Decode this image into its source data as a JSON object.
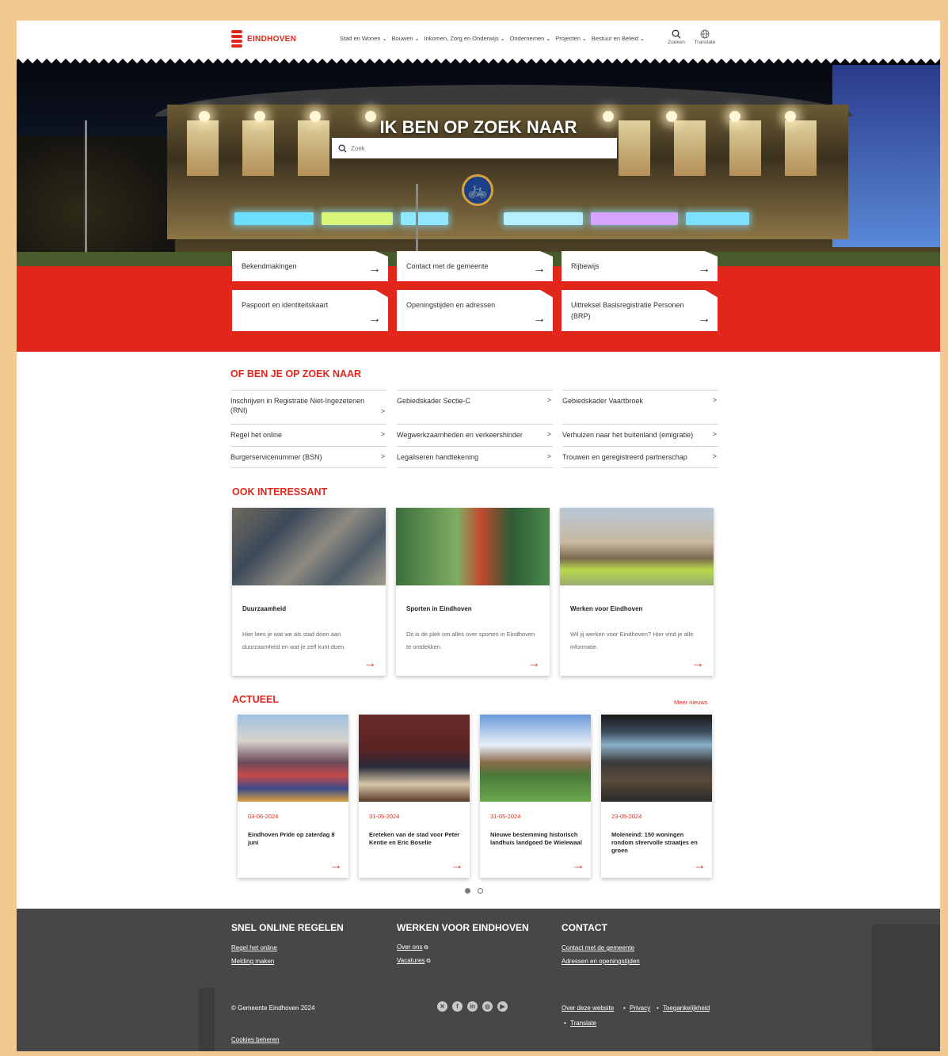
{
  "header": {
    "logo_text": "EINDHOVEN",
    "nav": [
      {
        "label": "Stad en Wonen"
      },
      {
        "label": "Bouwen"
      },
      {
        "label": "Inkomen, Zorg en Onderwijs"
      },
      {
        "label": "Ondernemen"
      },
      {
        "label": "Projecten"
      },
      {
        "label": "Bestuur en Beleid"
      }
    ],
    "search_label": "Zoeken",
    "translate_label": "Translate"
  },
  "hero": {
    "title": "IK BEN OP ZOEK NAAR",
    "search_placeholder": "Zoek",
    "quick_links": [
      {
        "label": "Bekendmakingen"
      },
      {
        "label": "Contact met de gemeente"
      },
      {
        "label": "Rijbewijs"
      },
      {
        "label": "Paspoort en identiteitskaart"
      },
      {
        "label": "Openingstijden en adressen"
      },
      {
        "label": "Uittreksel Basisregistratie Personen (BRP)"
      }
    ]
  },
  "search_more": {
    "title": "OF BEN JE OP ZOEK NAAR",
    "links": [
      {
        "label": "Inschrijven in Registratie Niet-Ingezetenen (RNI)"
      },
      {
        "label": "Gebiedskader Sectie-C"
      },
      {
        "label": "Gebiedskader Vaartbroek"
      },
      {
        "label": "Regel het online"
      },
      {
        "label": "Wegwerkzaamheden en verkeershinder"
      },
      {
        "label": "Verhuizen naar het buitenland (emigratie)"
      },
      {
        "label": "Burgerservicenummer (BSN)"
      },
      {
        "label": "Legaliseren handtekening"
      },
      {
        "label": "Trouwen en geregistreerd partnerschap"
      }
    ]
  },
  "interesting": {
    "title": "OOK INTERESSANT",
    "cards": [
      {
        "title": "Duurzaamheid",
        "desc": "Hier lees je wat we als stad doen aan duurzaamheid en wat je zelf kunt doen."
      },
      {
        "title": "Sporten in Eindhoven",
        "desc": "Dit is de plek om alles over sporten in Eindhoven te ontdekken."
      },
      {
        "title": "Werken voor Eindhoven",
        "desc": "Wil jij werken voor Eindhoven? Hier vind je alle informatie."
      }
    ]
  },
  "news": {
    "title": "ACTUEEL",
    "more_label": "Meer nieuws",
    "items": [
      {
        "date": "03-06-2024",
        "title": "Eindhoven Pride op zaterdag 8 juni"
      },
      {
        "date": "31-05-2024",
        "title": "Ereteken van de stad voor Peter Kentie en Eric Boselie"
      },
      {
        "date": "31-05-2024",
        "title": "Nieuwe bestemming historisch landhuis landgoed De Wielewaal"
      },
      {
        "date": "23-05-2024",
        "title": "Moleneind: 150 woningen rondom sfeervolle straatjes en groen"
      }
    ]
  },
  "footer": {
    "col1_title": "SNEL ONLINE REGELEN",
    "col1_links": [
      {
        "label": "Regel het online"
      },
      {
        "label": "Melding maken"
      }
    ],
    "col2_title": "WERKEN VOOR EINDHOVEN",
    "col2_links": [
      {
        "label": "Over ons"
      },
      {
        "label": "Vacatures"
      }
    ],
    "col3_title": "CONTACT",
    "col3_links": [
      {
        "label": "Contact met de gemeente"
      },
      {
        "label": "Adressen en openingstijden"
      }
    ],
    "copyright": "© Gemeente Eindhoven 2024",
    "legal_links": [
      {
        "label": "Over deze website"
      },
      {
        "label": "Privacy"
      },
      {
        "label": "Toegankelijkheid"
      },
      {
        "label": "Translate"
      }
    ],
    "cookies_label": "Cookies beheren",
    "socials": [
      "x-icon",
      "facebook-icon",
      "linkedin-icon",
      "instagram-icon",
      "youtube-icon"
    ]
  },
  "colors": {
    "brand_red": "#e1261c",
    "footer_bg": "#474747",
    "frame_bg": "#f4c891"
  }
}
